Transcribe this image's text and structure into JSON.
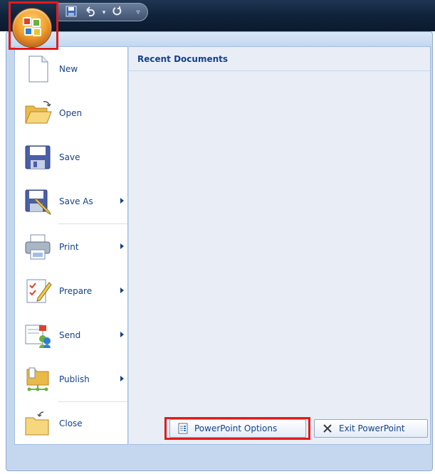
{
  "quick_access": {
    "save_icon": "save-icon",
    "undo_icon": "undo-icon",
    "undo_dropdown_icon": "dropdown-arrow-icon",
    "redo_icon": "redo-icon",
    "customize_icon": "customize-qat-icon"
  },
  "office_button": {
    "icon": "office-logo-icon"
  },
  "menu": {
    "items": [
      {
        "label": "New",
        "icon": "new-document-icon",
        "submenu": false
      },
      {
        "label": "Open",
        "icon": "open-folder-icon",
        "submenu": false
      },
      {
        "label": "Save",
        "icon": "save-floppy-icon",
        "submenu": false
      },
      {
        "label": "Save As",
        "icon": "save-as-icon",
        "submenu": true
      },
      {
        "label": "Print",
        "icon": "printer-icon",
        "submenu": true
      },
      {
        "label": "Prepare",
        "icon": "prepare-icon",
        "submenu": true
      },
      {
        "label": "Send",
        "icon": "send-icon",
        "submenu": true
      },
      {
        "label": "Publish",
        "icon": "publish-icon",
        "submenu": true
      },
      {
        "label": "Close",
        "icon": "close-folder-icon",
        "submenu": false
      }
    ]
  },
  "recent_documents": {
    "title": "Recent Documents"
  },
  "footer": {
    "options_label": "PowerPoint Options",
    "exit_label": "Exit PowerPoint"
  },
  "colors": {
    "highlight": "#e21b1b",
    "menu_text": "#15428b",
    "menu_bg": "#c5d7ef",
    "recent_bg": "#e9eef6"
  }
}
